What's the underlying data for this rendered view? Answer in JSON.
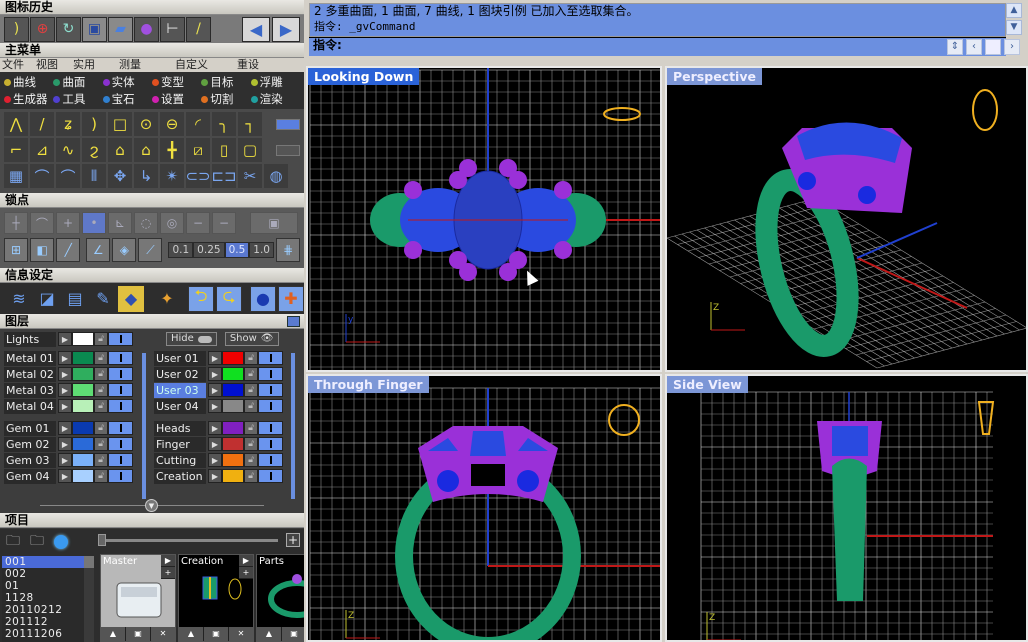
{
  "left_panel": {
    "history": {
      "title": "图标历史",
      "icons": [
        "curve-edit-icon",
        "target-icon",
        "rotate-view-icon",
        "save-icon",
        "open-folder-icon",
        "sphere-material-icon",
        "dimension-icon",
        "line-icon"
      ],
      "back_label": "◀",
      "forward_label": "▶"
    },
    "main_menu": {
      "title": "主菜单",
      "menu_items": [
        "文件",
        "视图",
        "实用",
        "测量",
        "自定义",
        "重设"
      ],
      "categories": [
        {
          "label": "曲线",
          "color": "#c8b030"
        },
        {
          "label": "曲面",
          "color": "#2a9a6a"
        },
        {
          "label": "实体",
          "color": "#8a30d0"
        },
        {
          "label": "变型",
          "color": "#e05020"
        },
        {
          "label": "目标",
          "color": "#60a040"
        },
        {
          "label": "浮雕",
          "color": "#b0c030"
        },
        {
          "label": "生成器",
          "color": "#e02030"
        },
        {
          "label": "工具",
          "color": "#5040d0"
        },
        {
          "label": "宝石",
          "color": "#3080d0"
        },
        {
          "label": "设置",
          "color": "#d020b0"
        },
        {
          "label": "切割",
          "color": "#e07020"
        },
        {
          "label": "渲染",
          "color": "#20a0a0"
        }
      ]
    },
    "snap": {
      "title": "锁点",
      "step_values": [
        "0.1",
        "0.25",
        "0.5",
        "1.0"
      ],
      "selected_step": "0.5"
    },
    "info": {
      "title": "信息设定"
    },
    "layers": {
      "title": "图层",
      "lights_label": "Lights",
      "hide_label": "Hide",
      "show_label": "Show",
      "left": [
        {
          "name": "Metal 01",
          "color": "#0a8a50"
        },
        {
          "name": "Metal 02",
          "color": "#2fae5e"
        },
        {
          "name": "Metal 03",
          "color": "#5edc74"
        },
        {
          "name": "Metal 04",
          "color": "#b8f0b8"
        },
        {
          "name": "Gem 01",
          "color": "#0a3ab0"
        },
        {
          "name": "Gem 02",
          "color": "#2a6ad8"
        },
        {
          "name": "Gem 03",
          "color": "#7ab0f8"
        },
        {
          "name": "Gem 04",
          "color": "#a8d0ff"
        }
      ],
      "right": [
        {
          "name": "User 01",
          "color": "#f00000"
        },
        {
          "name": "User 02",
          "color": "#10e020"
        },
        {
          "name": "User 03",
          "color": "#0010d0",
          "selected": true
        },
        {
          "name": "User 04",
          "color": "#888888"
        },
        {
          "name": "Heads",
          "color": "#8020c0"
        },
        {
          "name": "Finger",
          "color": "#c03030"
        },
        {
          "name": "Cutting",
          "color": "#f07010"
        },
        {
          "name": "Creation",
          "color": "#f0b010"
        }
      ],
      "lights_color": "#ffffff"
    },
    "project": {
      "title": "项目",
      "list": [
        "001",
        "002",
        "01",
        "1128",
        "20110212",
        "201112",
        "20111206"
      ],
      "selected": "001",
      "thumbnails": [
        {
          "label": "Master"
        },
        {
          "label": "Creation"
        },
        {
          "label": "Parts"
        }
      ],
      "add_label": "+"
    }
  },
  "command": {
    "history_line1": "2 多重曲面, 1 曲面, 7 曲线, 1 图块引例 已加入至选取集合。",
    "history_line2": "指令: _gvCommand",
    "prompt": "指令:",
    "input_value": ""
  },
  "viewports": [
    {
      "title": "Looking Down",
      "active": true
    },
    {
      "title": "Perspective",
      "active": false
    },
    {
      "title": "Through Finger",
      "active": false
    },
    {
      "title": "Side View",
      "active": false
    }
  ],
  "colors": {
    "metal": "#1a9a6a",
    "heads": "#9a30d8",
    "gems": "#2a4ae0",
    "grid": "#c8c8c8",
    "axis_x": "#c01818",
    "axis_y": "#2040d0",
    "widget": "#f0b020"
  }
}
